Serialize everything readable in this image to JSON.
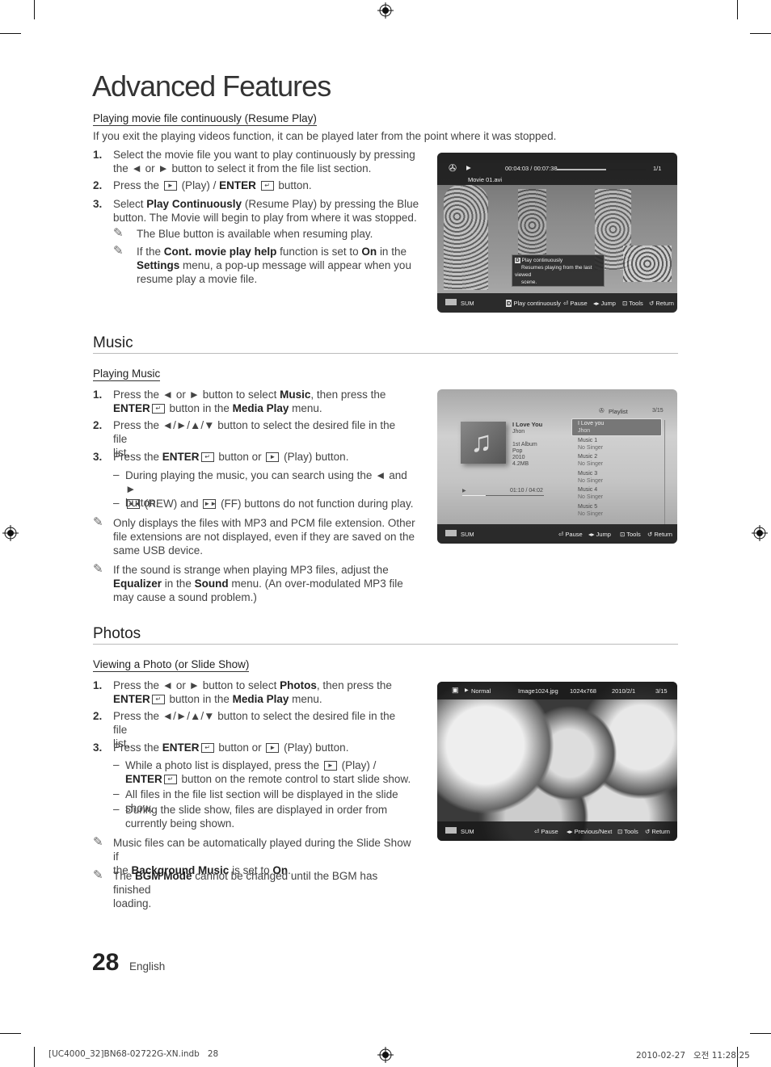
{
  "page": {
    "title": "Advanced Features",
    "page_number": "28",
    "language": "English",
    "footer_left": "[UC4000_32]BN68-02722G-XN.indb   28",
    "footer_right": "2010-02-27   오전 11:28:25"
  },
  "resume": {
    "heading": "Playing movie file continuously (Resume Play)",
    "intro": "If you exit the playing videos function, it can be played later from the point where it was stopped.",
    "steps": [
      {
        "num": "1.",
        "line1": "Select the movie file you want to play continuously by pressing",
        "line2": "the ◄ or ► button to select it from the file list section."
      },
      {
        "num": "2.",
        "pre": "Press the",
        "mid": "(Play) /",
        "bold": "ENTER",
        "post": "button."
      },
      {
        "num": "3.",
        "pre": "Select",
        "bold": "Play Continuously",
        "post": "(Resume Play) by pressing the Blue",
        "line2": "button. The Movie will begin to play from where it was stopped."
      }
    ],
    "notes": [
      {
        "text": "The Blue button is available when resuming play."
      },
      {
        "p1": "If the",
        "b1": "Cont. movie play help",
        "p2": "function is set to",
        "b2": "On",
        "p3": "in the",
        "b3": "Settings",
        "p4": "menu, a pop-up message will appear when you",
        "line3": "resume play a movie file."
      }
    ],
    "screen": {
      "time": "00:04:03 / 00:07:38",
      "progress": 0.55,
      "count": "1/1",
      "filename": "Movie 01.avi",
      "popup_title": "Play continuously",
      "popup_text1": "Resumes playing from the last viewed",
      "popup_text2": "scene.",
      "popup_key": "D",
      "device": "SUM",
      "bottom": [
        "Play continuously",
        "Pause",
        "Jump",
        "Tools",
        "Return"
      ]
    }
  },
  "music": {
    "section": "Music",
    "heading": "Playing Music",
    "steps": [
      {
        "num": "1.",
        "pre": "Press the ◄ or ► button to select",
        "b1": "Music",
        "post": ", then press the",
        "b2": "ENTER",
        "post2": "button in the",
        "b3": "Media Play",
        "post3": "menu."
      },
      {
        "num": "2.",
        "line1": "Press the ◄/►/▲/▼ button to select the desired file in the file",
        "line2": "list."
      },
      {
        "num": "3.",
        "pre": "Press the",
        "b1": "ENTER",
        "post": "button or",
        "post2": "(Play) button."
      }
    ],
    "dashes": [
      {
        "line1": "During playing the music, you can search using the ◄ and ►",
        "line2": "button."
      },
      {
        "rew": "(REW) and",
        "ff": "(FF) buttons do not function during play."
      }
    ],
    "notes": [
      {
        "line1": "Only displays the files with MP3 and PCM file extension. Other",
        "line2": "file extensions are not displayed, even if they are saved on the",
        "line3": "same USB device."
      },
      {
        "line1": "If the sound is strange when playing MP3 files, adjust the",
        "b1": "Equalizer",
        "p2": "in the",
        "b2": "Sound",
        "p3": "menu. (An over-modulated MP3 file",
        "line3": "may cause a sound problem.)"
      }
    ],
    "screen": {
      "playlist_label": "Playlist",
      "count": "3/15",
      "track_title": "I Love You",
      "artist": "Jhon",
      "album": "1st Album",
      "genre": "Pop",
      "year": "2010",
      "size": "4.2MB",
      "time": "01:10 / 04:02",
      "progress": 0.29,
      "playlist": [
        {
          "title": "I Love you",
          "artist": "Jhon"
        },
        {
          "title": "Music 1",
          "artist": "No Singer"
        },
        {
          "title": "Music 2",
          "artist": "No Singer"
        },
        {
          "title": "Music 3",
          "artist": "No Singer"
        },
        {
          "title": "Music 4",
          "artist": "No Singer"
        },
        {
          "title": "Music 5",
          "artist": "No Singer"
        }
      ],
      "device": "SUM",
      "bottom": [
        "Pause",
        "Jump",
        "Tools",
        "Return"
      ]
    }
  },
  "photos": {
    "section": "Photos",
    "heading": "Viewing a Photo (or Slide Show)",
    "steps": [
      {
        "num": "1.",
        "pre": "Press the ◄ or ► button to select",
        "b1": "Photos",
        "post": ", then press the",
        "b2": "ENTER",
        "post2": "button in the",
        "b3": "Media Play",
        "post3": "menu."
      },
      {
        "num": "2.",
        "line1": "Press the ◄/►/▲/▼ button to select the desired file in the file",
        "line2": "list."
      },
      {
        "num": "3.",
        "pre": "Press the",
        "b1": "ENTER",
        "post": "button or",
        "post2": "(Play) button."
      }
    ],
    "dashes": [
      {
        "pre": "While a photo list is displayed, press the",
        "mid": "(Play) /",
        "b": "ENTER",
        "post": "button on the remote control to start slide show."
      },
      {
        "line1": "All files in the file list section will be displayed in the slide show."
      },
      {
        "line1": "During the slide show, files are displayed in order from",
        "line2": "currently being shown."
      }
    ],
    "notes": [
      {
        "line1": "Music files can be automatically played during the Slide Show if",
        "p1": "the",
        "b1": "Background Music",
        "p2": "is set to",
        "b2": "On",
        "p3": "."
      },
      {
        "p1": "The",
        "b1": "BGM Mode",
        "p2": "cannot be changed until the BGM has finished",
        "line2": "loading."
      }
    ],
    "screen": {
      "mode": "Normal",
      "filename": "Image1024.jpg",
      "resolution": "1024x768",
      "date": "2010/2/1",
      "count": "3/15",
      "device": "SUM",
      "bottom": [
        "Pause",
        "Previous/Next",
        "Tools",
        "Return"
      ]
    }
  }
}
